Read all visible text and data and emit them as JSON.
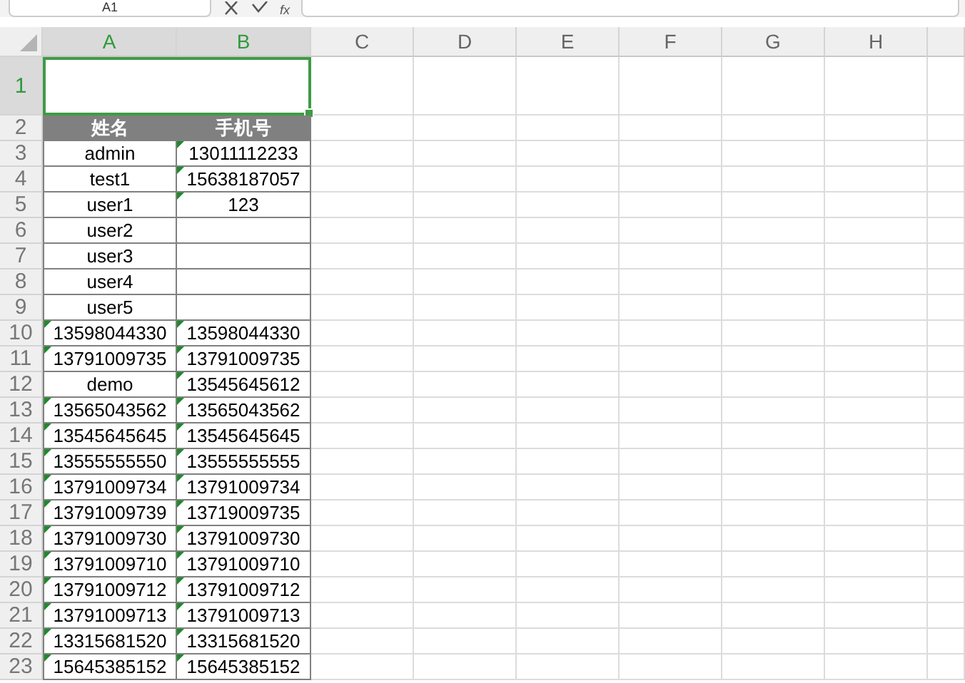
{
  "formula_bar": {
    "name_box": "A1",
    "function_label": "fx"
  },
  "columns": [
    {
      "label": "A",
      "selected": true
    },
    {
      "label": "B",
      "selected": true
    },
    {
      "label": "C",
      "selected": false
    },
    {
      "label": "D",
      "selected": false
    },
    {
      "label": "E",
      "selected": false
    },
    {
      "label": "F",
      "selected": false
    },
    {
      "label": "G",
      "selected": false
    },
    {
      "label": "H",
      "selected": false
    }
  ],
  "rows": [
    {
      "number": "1",
      "kind": "merged",
      "selected": true,
      "cells": []
    },
    {
      "number": "2",
      "kind": "header",
      "selected": false,
      "cells": [
        {
          "text": "姓名",
          "flag": false
        },
        {
          "text": "手机号",
          "flag": false
        }
      ]
    },
    {
      "number": "3",
      "kind": "data",
      "selected": false,
      "cells": [
        {
          "text": "admin",
          "flag": false
        },
        {
          "text": "13011112233",
          "flag": true
        }
      ]
    },
    {
      "number": "4",
      "kind": "data",
      "selected": false,
      "cells": [
        {
          "text": "test1",
          "flag": false
        },
        {
          "text": "15638187057",
          "flag": true
        }
      ]
    },
    {
      "number": "5",
      "kind": "data",
      "selected": false,
      "cells": [
        {
          "text": "user1",
          "flag": false
        },
        {
          "text": "123",
          "flag": true
        }
      ]
    },
    {
      "number": "6",
      "kind": "data",
      "selected": false,
      "cells": [
        {
          "text": "user2",
          "flag": false
        },
        {
          "text": "",
          "flag": false
        }
      ]
    },
    {
      "number": "7",
      "kind": "data",
      "selected": false,
      "cells": [
        {
          "text": "user3",
          "flag": false
        },
        {
          "text": "",
          "flag": false
        }
      ]
    },
    {
      "number": "8",
      "kind": "data",
      "selected": false,
      "cells": [
        {
          "text": "user4",
          "flag": false
        },
        {
          "text": "",
          "flag": false
        }
      ]
    },
    {
      "number": "9",
      "kind": "data",
      "selected": false,
      "cells": [
        {
          "text": "user5",
          "flag": false
        },
        {
          "text": "",
          "flag": false
        }
      ]
    },
    {
      "number": "10",
      "kind": "data",
      "selected": false,
      "cells": [
        {
          "text": "13598044330",
          "flag": true
        },
        {
          "text": "13598044330",
          "flag": true
        }
      ]
    },
    {
      "number": "11",
      "kind": "data",
      "selected": false,
      "cells": [
        {
          "text": "13791009735",
          "flag": true
        },
        {
          "text": "13791009735",
          "flag": true
        }
      ]
    },
    {
      "number": "12",
      "kind": "data",
      "selected": false,
      "cells": [
        {
          "text": "demo",
          "flag": false
        },
        {
          "text": "13545645612",
          "flag": true
        }
      ]
    },
    {
      "number": "13",
      "kind": "data",
      "selected": false,
      "cells": [
        {
          "text": "13565043562",
          "flag": true
        },
        {
          "text": "13565043562",
          "flag": true
        }
      ]
    },
    {
      "number": "14",
      "kind": "data",
      "selected": false,
      "cells": [
        {
          "text": "13545645645",
          "flag": true
        },
        {
          "text": "13545645645",
          "flag": true
        }
      ]
    },
    {
      "number": "15",
      "kind": "data",
      "selected": false,
      "cells": [
        {
          "text": "13555555550",
          "flag": true
        },
        {
          "text": "13555555555",
          "flag": true
        }
      ]
    },
    {
      "number": "16",
      "kind": "data",
      "selected": false,
      "cells": [
        {
          "text": "13791009734",
          "flag": true
        },
        {
          "text": "13791009734",
          "flag": true
        }
      ]
    },
    {
      "number": "17",
      "kind": "data",
      "selected": false,
      "cells": [
        {
          "text": "13791009739",
          "flag": true
        },
        {
          "text": "13719009735",
          "flag": true
        }
      ]
    },
    {
      "number": "18",
      "kind": "data",
      "selected": false,
      "cells": [
        {
          "text": "13791009730",
          "flag": true
        },
        {
          "text": "13791009730",
          "flag": true
        }
      ]
    },
    {
      "number": "19",
      "kind": "data",
      "selected": false,
      "cells": [
        {
          "text": "13791009710",
          "flag": true
        },
        {
          "text": "13791009710",
          "flag": true
        }
      ]
    },
    {
      "number": "20",
      "kind": "data",
      "selected": false,
      "cells": [
        {
          "text": "13791009712",
          "flag": true
        },
        {
          "text": "13791009712",
          "flag": true
        }
      ]
    },
    {
      "number": "21",
      "kind": "data",
      "selected": false,
      "cells": [
        {
          "text": "13791009713",
          "flag": true
        },
        {
          "text": "13791009713",
          "flag": true
        }
      ]
    },
    {
      "number": "22",
      "kind": "data",
      "selected": false,
      "cells": [
        {
          "text": "13315681520",
          "flag": true
        },
        {
          "text": "13315681520",
          "flag": true
        }
      ]
    },
    {
      "number": "23",
      "kind": "data",
      "selected": false,
      "cells": [
        {
          "text": "15645385152",
          "flag": true
        },
        {
          "text": "15645385152",
          "flag": true
        }
      ]
    }
  ]
}
